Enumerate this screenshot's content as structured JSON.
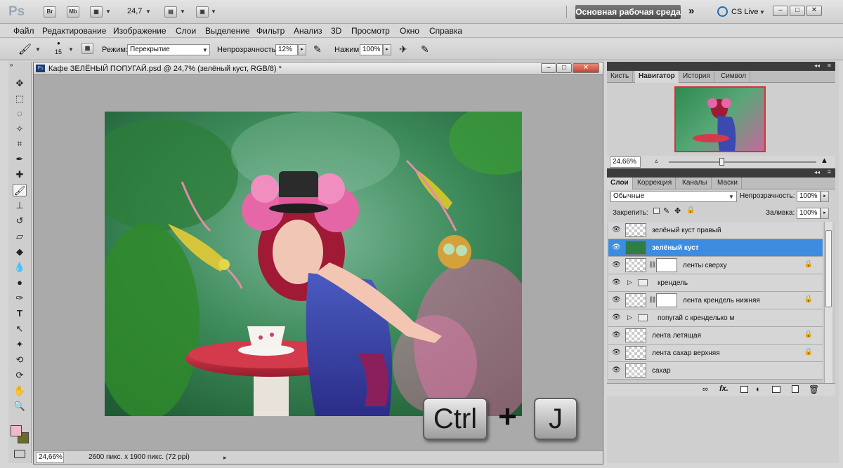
{
  "app": {
    "logo": "Ps",
    "bridge_label": "Br",
    "minibridge_label": "Mb",
    "zoom_value": "24,7",
    "workspace_label": "Основная рабочая среда",
    "cslive_label": "CS Live"
  },
  "menu": [
    "Файл",
    "Редактирование",
    "Изображение",
    "Слои",
    "Выделение",
    "Фильтр",
    "Анализ",
    "3D",
    "Просмотр",
    "Окно",
    "Справка"
  ],
  "options": {
    "brush_size": "15",
    "mode_label": "Режим:",
    "mode_value": "Перекрытие",
    "opacity_label": "Непрозрачность:",
    "opacity_value": "12%",
    "flow_label": "Нажим:",
    "flow_value": "100%"
  },
  "document": {
    "title": "Кафе ЗЕЛЁНЫЙ ПОПУГАЙ.psd @ 24,7% (зелёный куст, RGB/8) *",
    "zoom": "24,66%",
    "info": "2600 пикс. x 1900 пикс. (72 ppi)"
  },
  "overlay": {
    "key1": "Ctrl",
    "plus": "+",
    "key2": "J"
  },
  "navigator": {
    "tabs": [
      "Кисть",
      "Навигатор",
      "История",
      "Символ"
    ],
    "active_tab": 1,
    "zoom": "24.66%"
  },
  "layers_panel": {
    "tabs": [
      "Слои",
      "Коррекция",
      "Каналы",
      "Маски"
    ],
    "active_tab": 0,
    "blend_mode": "Обычные",
    "opacity_label": "Непрозрачность:",
    "opacity_value": "100%",
    "lock_label": "Закрепить:",
    "fill_label": "Заливка:",
    "fill_value": "100%",
    "layers": [
      {
        "name": "зелёный куст правый",
        "type": "layer",
        "selected": false,
        "mask": false,
        "locked": false
      },
      {
        "name": "зелёный куст",
        "type": "layer",
        "selected": true,
        "mask": false,
        "locked": false
      },
      {
        "name": "ленты сверху",
        "type": "layer",
        "selected": false,
        "mask": true,
        "locked": true
      },
      {
        "name": "крендель",
        "type": "group",
        "selected": false,
        "mask": false,
        "locked": false
      },
      {
        "name": "лента крендель нижняя",
        "type": "layer",
        "selected": false,
        "mask": true,
        "locked": true
      },
      {
        "name": "попугай с кренделько м",
        "type": "group",
        "selected": false,
        "mask": false,
        "locked": false
      },
      {
        "name": "лента летящая",
        "type": "layer",
        "selected": false,
        "mask": false,
        "locked": true
      },
      {
        "name": "лента сахар верхняя",
        "type": "layer",
        "selected": false,
        "mask": false,
        "locked": true
      },
      {
        "name": "сахар",
        "type": "layer",
        "selected": false,
        "mask": false,
        "locked": false
      }
    ]
  },
  "colors": {
    "selection": "#3d8ce0",
    "foreground": "#f2b8c6",
    "background": "#6b6a2a"
  }
}
